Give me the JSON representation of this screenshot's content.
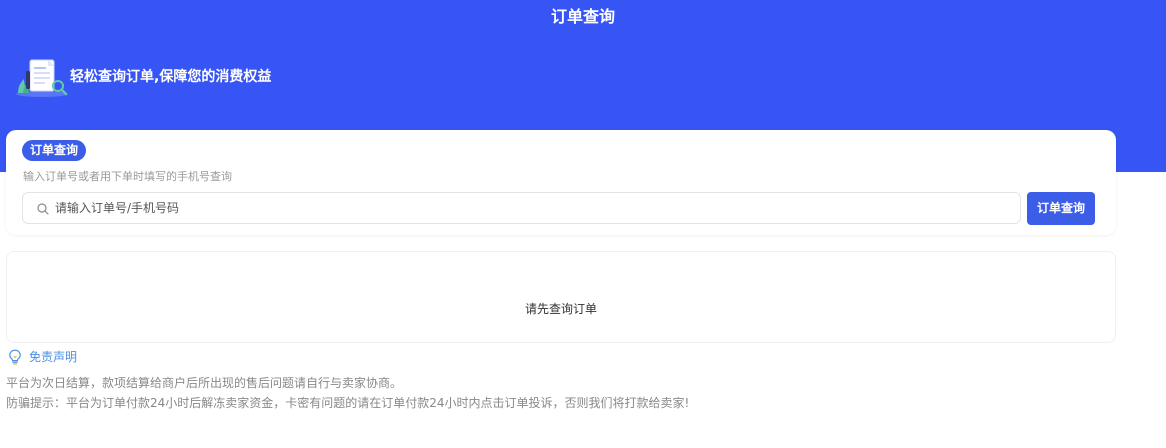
{
  "header": {
    "title": "订单查询",
    "slogan": "轻松查询订单,保障您的消费权益",
    "illustration_icon": "document-search-illustration"
  },
  "query": {
    "badge_label": "订单查询",
    "hint": "输入订单号或者用下单时填写的手机号查询",
    "search_placeholder": "请输入订单号/手机号码",
    "search_value": "",
    "search_icon": "search-icon",
    "button_label": "订单查询"
  },
  "result": {
    "empty_text": "请先查询订单"
  },
  "disclaimer": {
    "icon": "lightbulb-icon",
    "title": "免责声明",
    "line1": "平台为次日结算，款项结算给商户后所出现的售后问题请自行与卖家协商。",
    "line2": "防骗提示：平台为订单付款24小时后解冻卖家资金，卡密有问题的请在订单付款24小时内点击订单投诉，否则我们将打款给卖家!"
  },
  "colors": {
    "hero_bg": "#3754f5",
    "accent": "#3b5de7",
    "disclaimer_title": "#4a90e2",
    "muted_text": "#888888"
  }
}
